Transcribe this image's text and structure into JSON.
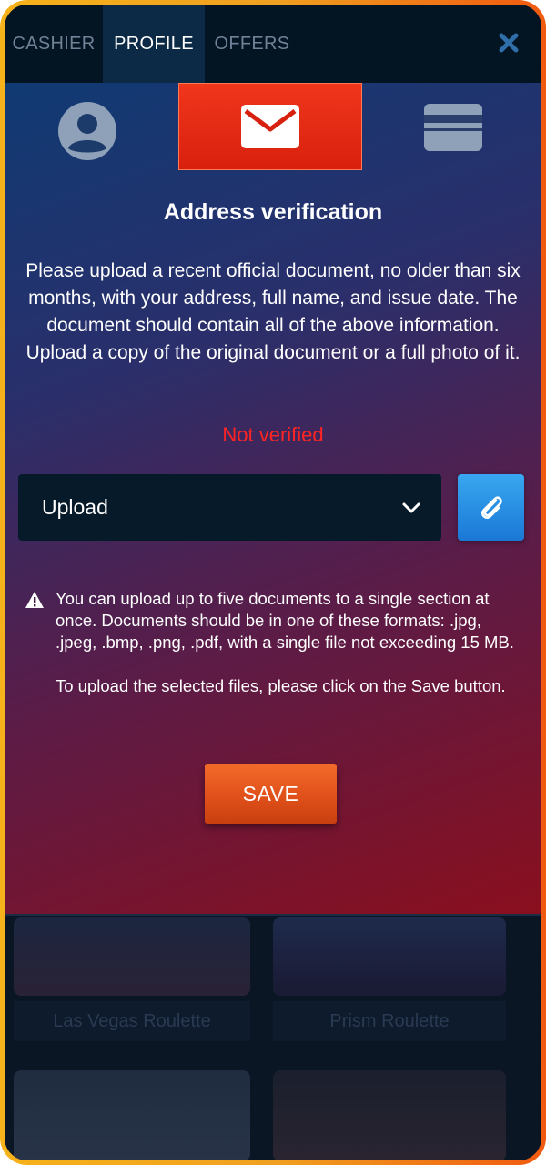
{
  "tabs": [
    {
      "label": "CASHIER",
      "active": false
    },
    {
      "label": "PROFILE",
      "active": true
    },
    {
      "label": "OFFERS",
      "active": false
    }
  ],
  "close_icon": "close-icon",
  "verification_icons": [
    "user-icon",
    "mail-icon",
    "card-icon"
  ],
  "title": "Address verification",
  "description": "Please upload a recent official document, no older than six months, with your address, full name, and issue date. The document should contain all of the above information. Upload a copy of the original document or a full photo of it.",
  "status": "Not verified",
  "upload": {
    "label": "Upload"
  },
  "notice": {
    "paragraph1": "You can upload up to five documents to a single section at once. Documents should be in one of these formats: .jpg, .jpeg, .bmp, .png, .pdf, with a single file not exceeding 15 MB.",
    "paragraph2": "To upload the selected files, please click on the Save button."
  },
  "save_label": "SAVE",
  "background_games": [
    "Las Vegas Roulette",
    "Prism Roulette"
  ],
  "colors": {
    "accent_orange": "#e0501a",
    "status_red": "#ff2424",
    "attach_blue": "#1b78d6",
    "frame": "#f6b21a"
  }
}
